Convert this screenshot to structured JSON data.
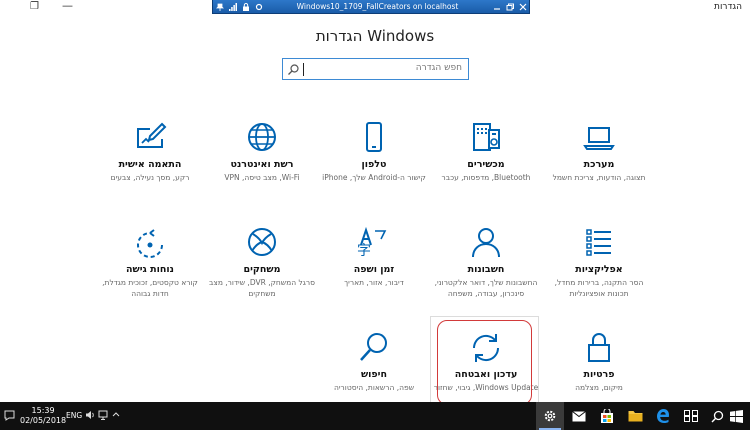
{
  "window": {
    "app_title": "הגדרות",
    "restore_glyph": "❐",
    "minimize_glyph": "—"
  },
  "remote_bar": {
    "title": "Windows10_1709_FallCreators on localhost",
    "left_icons": [
      "pin-icon",
      "signal-icon",
      "lock-icon",
      "options-icon"
    ],
    "right_icons": [
      "minimize-icon",
      "restore-icon",
      "close-icon"
    ]
  },
  "header": {
    "title": "Windows הגדרות"
  },
  "search": {
    "placeholder": "חפש הגדרה"
  },
  "tiles": [
    {
      "title": "מערכת",
      "desc": "תצוגה, הודעות, צריכת חשמל",
      "icon": "laptop-icon"
    },
    {
      "title": "מכשירים",
      "desc": "Bluetooth, מדפסות, עכבר",
      "icon": "devices-icon"
    },
    {
      "title": "טלפון",
      "desc": "קישור ה-Android שלך, iPhone",
      "icon": "phone-icon"
    },
    {
      "title": "רשת ואינטרנט",
      "desc": "Wi-Fi, מצב טיסה, VPN",
      "icon": "globe-icon"
    },
    {
      "title": "התאמה אישית",
      "desc": "רקע, מסך נעילה, צבעים",
      "icon": "personalization-icon"
    },
    {
      "title": "אפליקציות",
      "desc": "הסר התקנה, ברירות מחדל, תכונות אופציונליות",
      "icon": "apps-icon"
    },
    {
      "title": "חשבונות",
      "desc": "החשבונות שלך, דואר אלקטרוני, סינכרון, עבודה, משפחה",
      "icon": "person-icon"
    },
    {
      "title": "זמן ושפה",
      "desc": "דיבור, אזור, תאריך",
      "icon": "time-language-icon"
    },
    {
      "title": "משחקים",
      "desc": "סרגל המשחק, DVR, שידור, מצב משחקים",
      "icon": "xbox-icon"
    },
    {
      "title": "נוחות גישה",
      "desc": "קורא טקסטים, זכוכית מגדלת, חדות גבוהה",
      "icon": "ease-of-access-icon"
    },
    {
      "title": "פרטיות",
      "desc": "מיקום, מצלמה",
      "icon": "lock-icon"
    },
    {
      "title": "עדכון ואבטחה",
      "desc": "Windows Update, גיבוי, שחזור",
      "icon": "update-icon"
    },
    {
      "title": "חיפוש",
      "desc": "שפה, הרשאות, היסטוריה",
      "icon": "search-icon"
    }
  ],
  "taskbar": {
    "time": "15:39",
    "date": "02/05/2018",
    "lang": "ENG",
    "apps": [
      "settings-icon",
      "mail-icon",
      "store-icon",
      "explorer-icon",
      "edge-icon",
      "task-view-icon",
      "search-icon",
      "start-icon"
    ]
  },
  "colors": {
    "accent": "#0063b1",
    "highlight": "#d23a3a",
    "rdbar": "#2d77c9",
    "taskbar": "#101010"
  }
}
